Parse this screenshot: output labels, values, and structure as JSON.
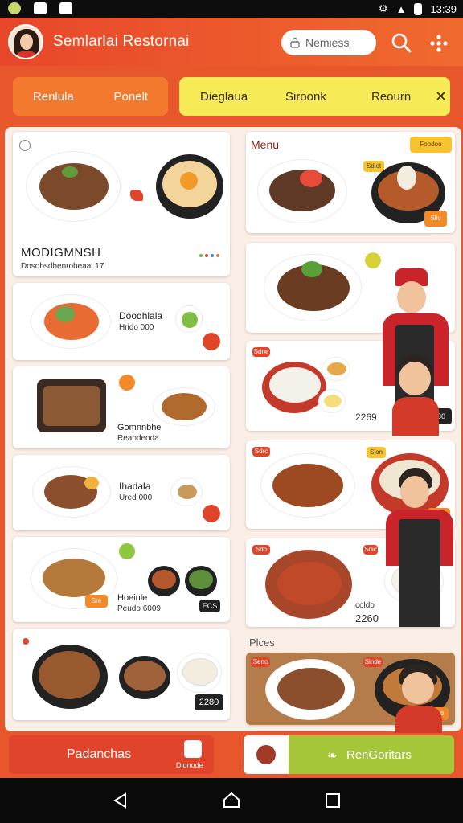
{
  "statusbar": {
    "time": "13:39"
  },
  "appbar": {
    "title": "Semlarlai Restornai",
    "search_placeholder": "Nemiess"
  },
  "tabs_left": [
    "Renlula",
    "Ponelt"
  ],
  "tabs_right": [
    "Dieglaua",
    "Siroonk",
    "Reourn"
  ],
  "cards_left": [
    {
      "title": "MODIGMNSH",
      "subtitle": "Dosobsdhenrobeaal 17"
    },
    {
      "title": "Doodhlala",
      "subtitle": "Hrido 000"
    },
    {
      "title": "Gomnnbhe",
      "subtitle": "Reaodeoda"
    },
    {
      "title": "Ihadala",
      "subtitle": "Ured 000"
    },
    {
      "title": "Hoeinle",
      "subtitle": "Peudo 6009",
      "badge": "Sre",
      "price": "ECS"
    },
    {
      "price": "2280"
    }
  ],
  "cards_right": {
    "menu_title": "Menu",
    "menu_badge": "Foodoo",
    "card1_badges": [
      "Sdiot",
      "Sliv"
    ],
    "card3_badge": "Sdne",
    "card3_price_a": "2269",
    "card3_price_b": "2230",
    "card4_badges": [
      "Sdrc",
      "Sion",
      "Siter"
    ],
    "card5_badges": [
      "Sdo",
      "Sdic"
    ],
    "card5_price_label": "coldo",
    "card5_price": "2260",
    "section_label": "Plces",
    "card6_badges": [
      "Seno",
      "Sinde"
    ],
    "card6_price": "Seoo"
  },
  "bottom": {
    "left_label": "Padanchas",
    "left_sub": "Dionode",
    "right_label": "RenGoritars"
  },
  "colors": {
    "accent": "#e8472a",
    "yellow": "#f7ea57",
    "green": "#a6c63a"
  }
}
